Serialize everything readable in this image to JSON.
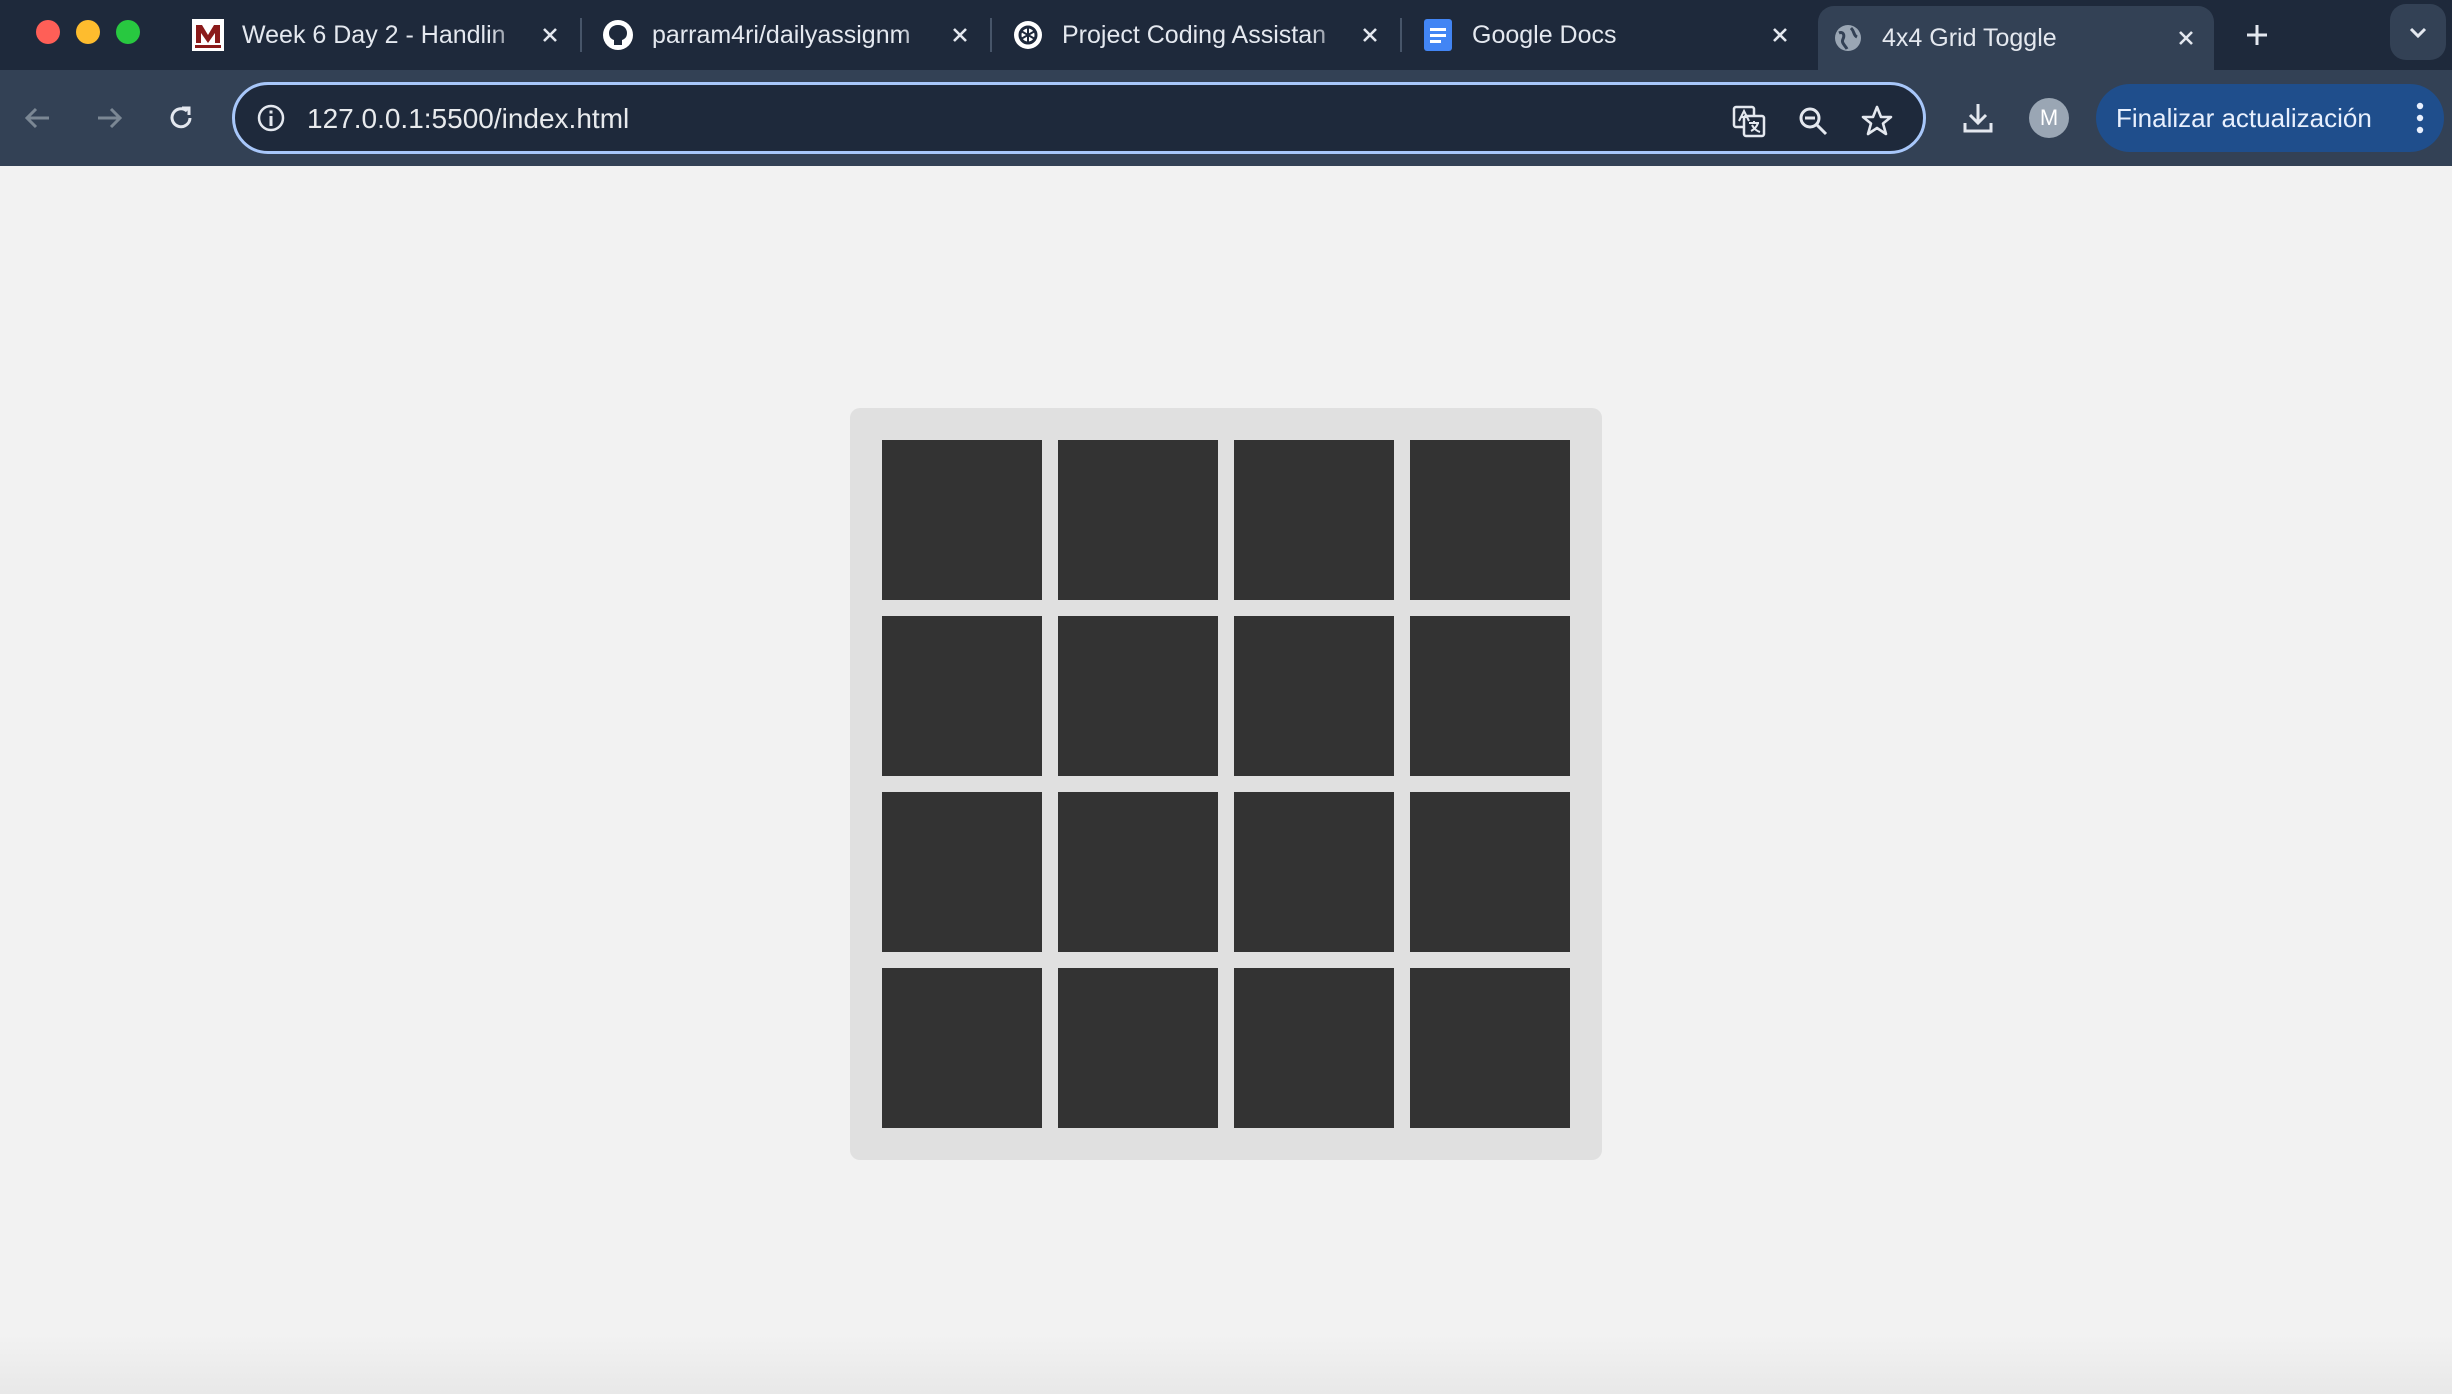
{
  "tabs": [
    {
      "title": "Week 6 Day 2 - Handlin",
      "favicon": "mtech-logo-icon",
      "active": false
    },
    {
      "title": "parram4ri/dailyassignm",
      "favicon": "github-icon",
      "active": false
    },
    {
      "title": "Project Coding Assistan",
      "favicon": "chatgpt-icon",
      "active": false
    },
    {
      "title": "Google Docs",
      "favicon": "google-docs-icon",
      "active": false
    },
    {
      "title": "4x4 Grid Toggle",
      "favicon": "globe-icon",
      "active": true
    }
  ],
  "toolbar": {
    "url": "127.0.0.1:5500/index.html",
    "profile_initial": "M",
    "update_button_label": "Finalizar actualización"
  },
  "grid": {
    "rows": 4,
    "columns": 4,
    "cell_color": "#333333",
    "container_color": "#e0e0e0"
  },
  "colors": {
    "tabstrip": "#1e293b",
    "toolbar": "#334155",
    "omnibox_border": "#a8c7fa",
    "update_button": "#1f4e8c",
    "page_background": "#f2f2f2"
  }
}
